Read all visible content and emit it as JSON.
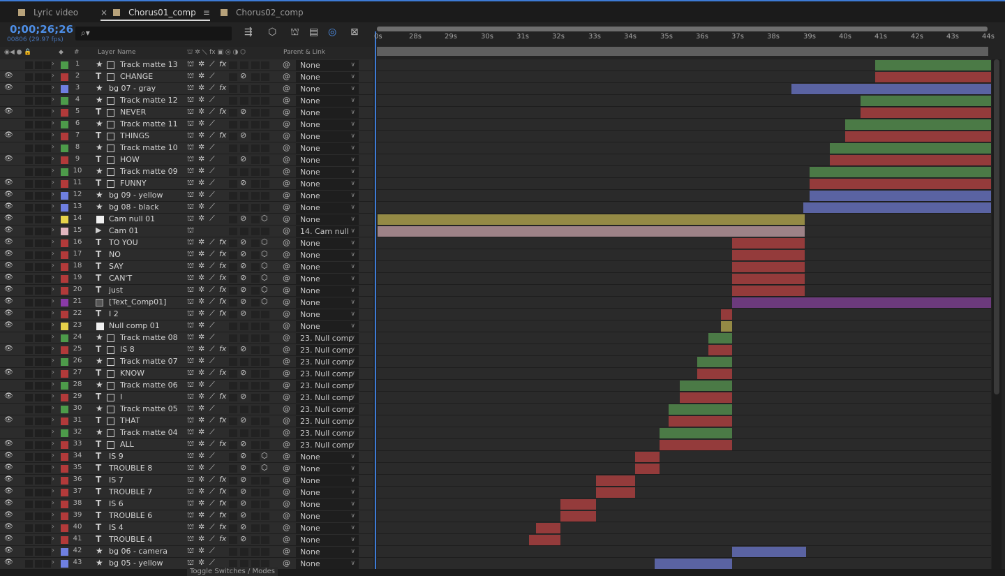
{
  "tabs": [
    {
      "label": "Lyric video",
      "active": false
    },
    {
      "label": "Chorus01_comp",
      "active": true
    },
    {
      "label": "Chorus02_comp",
      "active": false
    }
  ],
  "timecode": "0;00;26;26",
  "fps": "00806 (29.97 fps)",
  "header": {
    "layer_name": "Layer Name",
    "num": "#",
    "parent": "Parent & Link"
  },
  "ruler": [
    "0s",
    "28s",
    "29s",
    "30s",
    "31s",
    "32s",
    "33s",
    "34s",
    "35s",
    "36s",
    "37s",
    "38s",
    "39s",
    "40s",
    "41s",
    "42s",
    "43s",
    "44s"
  ],
  "toggle_label": "Toggle Switches / Modes",
  "colors": {
    "green": "#4d9b4a",
    "red": "#b23a3a",
    "blue": "#6f7fe0",
    "yellow": "#e6d24a",
    "pink": "#e2b5bf",
    "purple": "#8a3aa8",
    "accent": "#3d7bd6"
  },
  "layers": [
    {
      "num": "1",
      "name": "Track matte 13",
      "kind": "star",
      "color": "green",
      "eye": false,
      "fx": true,
      "motion": false,
      "cube": false,
      "parent": "None",
      "bar": [
        1254,
        1420
      ],
      "barcolor": "#4b7a46"
    },
    {
      "num": "2",
      "name": "CHANGE",
      "kind": "text",
      "color": "red",
      "eye": true,
      "fx": false,
      "motion": true,
      "cube": false,
      "parent": "None",
      "bar": [
        1254,
        1420
      ],
      "barcolor": "#943b3b"
    },
    {
      "num": "3",
      "name": "bg 07 - gray",
      "kind": "star",
      "color": "blue",
      "eye": true,
      "fx": true,
      "motion": false,
      "cube": false,
      "parent": "None",
      "bar": [
        1134,
        1420
      ],
      "barcolor": "#5a63a2"
    },
    {
      "num": "4",
      "name": "Track matte 12",
      "kind": "star",
      "color": "green",
      "eye": false,
      "fx": false,
      "motion": false,
      "cube": false,
      "parent": "None",
      "bar": [
        1233,
        1420
      ],
      "barcolor": "#4b7a46"
    },
    {
      "num": "5",
      "name": "NEVER",
      "kind": "text",
      "color": "red",
      "eye": true,
      "fx": true,
      "motion": true,
      "cube": false,
      "parent": "None",
      "bar": [
        1233,
        1420
      ],
      "barcolor": "#943b3b"
    },
    {
      "num": "6",
      "name": "Track matte 11",
      "kind": "star",
      "color": "green",
      "eye": false,
      "fx": false,
      "motion": false,
      "cube": false,
      "parent": "None",
      "bar": [
        1211,
        1420
      ],
      "barcolor": "#4b7a46"
    },
    {
      "num": "7",
      "name": "THINGS",
      "kind": "text",
      "color": "red",
      "eye": true,
      "fx": true,
      "motion": true,
      "cube": false,
      "parent": "None",
      "bar": [
        1211,
        1420
      ],
      "barcolor": "#943b3b"
    },
    {
      "num": "8",
      "name": "Track matte 10",
      "kind": "star",
      "color": "green",
      "eye": false,
      "fx": false,
      "motion": false,
      "cube": false,
      "parent": "None",
      "bar": [
        1189,
        1420
      ],
      "barcolor": "#4b7a46"
    },
    {
      "num": "9",
      "name": "HOW",
      "kind": "text",
      "color": "red",
      "eye": true,
      "fx": false,
      "motion": true,
      "cube": false,
      "parent": "None",
      "bar": [
        1189,
        1420
      ],
      "barcolor": "#943b3b"
    },
    {
      "num": "10",
      "name": "Track matte 09",
      "kind": "star",
      "color": "green",
      "eye": false,
      "fx": false,
      "motion": false,
      "cube": false,
      "parent": "None",
      "bar": [
        1160,
        1420
      ],
      "barcolor": "#4b7a46"
    },
    {
      "num": "11",
      "name": "FUNNY",
      "kind": "text",
      "color": "red",
      "eye": true,
      "fx": false,
      "motion": true,
      "cube": false,
      "parent": "None",
      "bar": [
        1160,
        1420
      ],
      "barcolor": "#943b3b"
    },
    {
      "num": "12",
      "name": "bg 09 - yellow",
      "kind": "star",
      "color": "blue",
      "eye": true,
      "fx": false,
      "motion": false,
      "cube": false,
      "parent": "None",
      "bar": [
        1160,
        1420
      ],
      "barcolor": "#5a63a2"
    },
    {
      "num": "13",
      "name": "bg 08 - black",
      "kind": "star",
      "color": "blue",
      "eye": true,
      "fx": false,
      "motion": false,
      "cube": false,
      "parent": "None",
      "bar": [
        1151,
        1420
      ],
      "barcolor": "#5a63a2"
    },
    {
      "num": "14",
      "name": "Cam null 01",
      "kind": "solid",
      "color": "yellow",
      "eye": true,
      "fx": false,
      "motion": true,
      "cube": true,
      "parent": "None",
      "bar": [
        541,
        1153
      ],
      "barcolor": "#948a45"
    },
    {
      "num": "15",
      "name": "Cam 01",
      "kind": "cam",
      "color": "pink",
      "eye": true,
      "fx": false,
      "motion": false,
      "cube": false,
      "parent": "14. Cam null",
      "bar": [
        541,
        1153
      ],
      "barcolor": "#9d8287"
    },
    {
      "num": "16",
      "name": "TO YOU",
      "kind": "text2",
      "color": "red",
      "eye": true,
      "fx": true,
      "motion": true,
      "cube": true,
      "parent": "None",
      "bar": [
        1049,
        1153
      ],
      "barcolor": "#943b3b"
    },
    {
      "num": "17",
      "name": "NO",
      "kind": "text2",
      "color": "red",
      "eye": true,
      "fx": true,
      "motion": true,
      "cube": true,
      "parent": "None",
      "bar": [
        1049,
        1153
      ],
      "barcolor": "#943b3b"
    },
    {
      "num": "18",
      "name": "SAY",
      "kind": "text2",
      "color": "red",
      "eye": true,
      "fx": true,
      "motion": true,
      "cube": true,
      "parent": "None",
      "bar": [
        1049,
        1153
      ],
      "barcolor": "#943b3b"
    },
    {
      "num": "19",
      "name": "CAN'T",
      "kind": "text2",
      "color": "red",
      "eye": true,
      "fx": true,
      "motion": true,
      "cube": true,
      "parent": "None",
      "bar": [
        1049,
        1153
      ],
      "barcolor": "#943b3b"
    },
    {
      "num": "20",
      "name": "just",
      "kind": "text2",
      "color": "red",
      "eye": true,
      "fx": true,
      "motion": true,
      "cube": true,
      "parent": "None",
      "bar": [
        1049,
        1153
      ],
      "barcolor": "#943b3b"
    },
    {
      "num": "21",
      "name": "[Text_Comp01]",
      "kind": "comp",
      "color": "purple",
      "eye": true,
      "fx": true,
      "motion": true,
      "cube": true,
      "parent": "None",
      "bar": [
        1049,
        1420
      ],
      "barcolor": "#6c3a7c"
    },
    {
      "num": "22",
      "name": "I 2",
      "kind": "text2",
      "color": "red",
      "eye": true,
      "fx": true,
      "motion": true,
      "cube": false,
      "parent": "None",
      "bar": [
        1033,
        1049
      ],
      "barcolor": "#943b3b"
    },
    {
      "num": "23",
      "name": "Null comp 01",
      "kind": "solid",
      "color": "yellow",
      "eye": true,
      "fx": false,
      "motion": false,
      "cube": false,
      "parent": "None",
      "bar": [
        1033,
        1049
      ],
      "barcolor": "#948a45"
    },
    {
      "num": "24",
      "name": "Track matte 08",
      "kind": "star",
      "color": "green",
      "eye": false,
      "fx": false,
      "motion": false,
      "cube": false,
      "parent": "23. Null comp",
      "bar": [
        1015,
        1049
      ],
      "barcolor": "#4b7a46"
    },
    {
      "num": "25",
      "name": "IS 8",
      "kind": "text",
      "color": "red",
      "eye": true,
      "fx": true,
      "motion": true,
      "cube": false,
      "parent": "23. Null comp",
      "bar": [
        1015,
        1049
      ],
      "barcolor": "#943b3b"
    },
    {
      "num": "26",
      "name": "Track matte 07",
      "kind": "star",
      "color": "green",
      "eye": false,
      "fx": false,
      "motion": false,
      "cube": false,
      "parent": "23. Null comp",
      "bar": [
        999,
        1049
      ],
      "barcolor": "#4b7a46"
    },
    {
      "num": "27",
      "name": "KNOW",
      "kind": "text",
      "color": "red",
      "eye": true,
      "fx": true,
      "motion": true,
      "cube": false,
      "parent": "23. Null comp",
      "bar": [
        999,
        1049
      ],
      "barcolor": "#943b3b"
    },
    {
      "num": "28",
      "name": "Track matte 06",
      "kind": "star",
      "color": "green",
      "eye": false,
      "fx": false,
      "motion": false,
      "cube": false,
      "parent": "23. Null comp",
      "bar": [
        974,
        1049
      ],
      "barcolor": "#4b7a46"
    },
    {
      "num": "29",
      "name": "I",
      "kind": "text",
      "color": "red",
      "eye": true,
      "fx": true,
      "motion": true,
      "cube": false,
      "parent": "23. Null comp",
      "bar": [
        974,
        1049
      ],
      "barcolor": "#943b3b"
    },
    {
      "num": "30",
      "name": "Track matte 05",
      "kind": "star",
      "color": "green",
      "eye": false,
      "fx": false,
      "motion": false,
      "cube": false,
      "parent": "23. Null comp",
      "bar": [
        958,
        1049
      ],
      "barcolor": "#4b7a46"
    },
    {
      "num": "31",
      "name": "THAT",
      "kind": "text",
      "color": "red",
      "eye": true,
      "fx": true,
      "motion": true,
      "cube": false,
      "parent": "23. Null comp",
      "bar": [
        958,
        1049
      ],
      "barcolor": "#943b3b"
    },
    {
      "num": "32",
      "name": "Track matte 04",
      "kind": "star",
      "color": "green",
      "eye": false,
      "fx": false,
      "motion": false,
      "cube": false,
      "parent": "23. Null comp",
      "bar": [
        945,
        1049
      ],
      "barcolor": "#4b7a46"
    },
    {
      "num": "33",
      "name": "ALL",
      "kind": "text",
      "color": "red",
      "eye": true,
      "fx": true,
      "motion": true,
      "cube": false,
      "parent": "23. Null comp",
      "bar": [
        945,
        1049
      ],
      "barcolor": "#943b3b"
    },
    {
      "num": "34",
      "name": "IS 9",
      "kind": "text2",
      "color": "red",
      "eye": true,
      "fx": false,
      "motion": true,
      "cube": true,
      "parent": "None",
      "bar": [
        910,
        945
      ],
      "barcolor": "#943b3b"
    },
    {
      "num": "35",
      "name": "TROUBLE 8",
      "kind": "text2",
      "color": "red",
      "eye": true,
      "fx": false,
      "motion": true,
      "cube": true,
      "parent": "None",
      "bar": [
        910,
        945
      ],
      "barcolor": "#943b3b"
    },
    {
      "num": "36",
      "name": "IS 7",
      "kind": "text2",
      "color": "red",
      "eye": true,
      "fx": true,
      "motion": true,
      "cube": false,
      "parent": "None",
      "bar": [
        854,
        910
      ],
      "barcolor": "#943b3b"
    },
    {
      "num": "37",
      "name": "TROUBLE 7",
      "kind": "text2",
      "color": "red",
      "eye": true,
      "fx": true,
      "motion": true,
      "cube": false,
      "parent": "None",
      "bar": [
        854,
        910
      ],
      "barcolor": "#943b3b"
    },
    {
      "num": "38",
      "name": "IS 6",
      "kind": "text2",
      "color": "red",
      "eye": true,
      "fx": true,
      "motion": true,
      "cube": false,
      "parent": "None",
      "bar": [
        803,
        854
      ],
      "barcolor": "#943b3b"
    },
    {
      "num": "39",
      "name": "TROUBLE 6",
      "kind": "text2",
      "color": "red",
      "eye": true,
      "fx": true,
      "motion": true,
      "cube": false,
      "parent": "None",
      "bar": [
        803,
        854
      ],
      "barcolor": "#943b3b"
    },
    {
      "num": "40",
      "name": "IS 4",
      "kind": "text2",
      "color": "red",
      "eye": true,
      "fx": true,
      "motion": true,
      "cube": false,
      "parent": "None",
      "bar": [
        768,
        803
      ],
      "barcolor": "#943b3b"
    },
    {
      "num": "41",
      "name": "TROUBLE 4",
      "kind": "text2",
      "color": "red",
      "eye": true,
      "fx": true,
      "motion": true,
      "cube": false,
      "parent": "None",
      "bar": [
        758,
        803
      ],
      "barcolor": "#943b3b"
    },
    {
      "num": "42",
      "name": "bg 06 - camera",
      "kind": "star",
      "color": "blue",
      "eye": true,
      "fx": false,
      "motion": false,
      "cube": false,
      "parent": "None",
      "bar": [
        1049,
        1155
      ],
      "barcolor": "#5a63a2"
    },
    {
      "num": "43",
      "name": "bg 05 - yellow",
      "kind": "star",
      "color": "blue",
      "eye": true,
      "fx": false,
      "motion": false,
      "cube": false,
      "parent": "None",
      "bar": [
        938,
        1049
      ],
      "barcolor": "#5a63a2"
    }
  ]
}
